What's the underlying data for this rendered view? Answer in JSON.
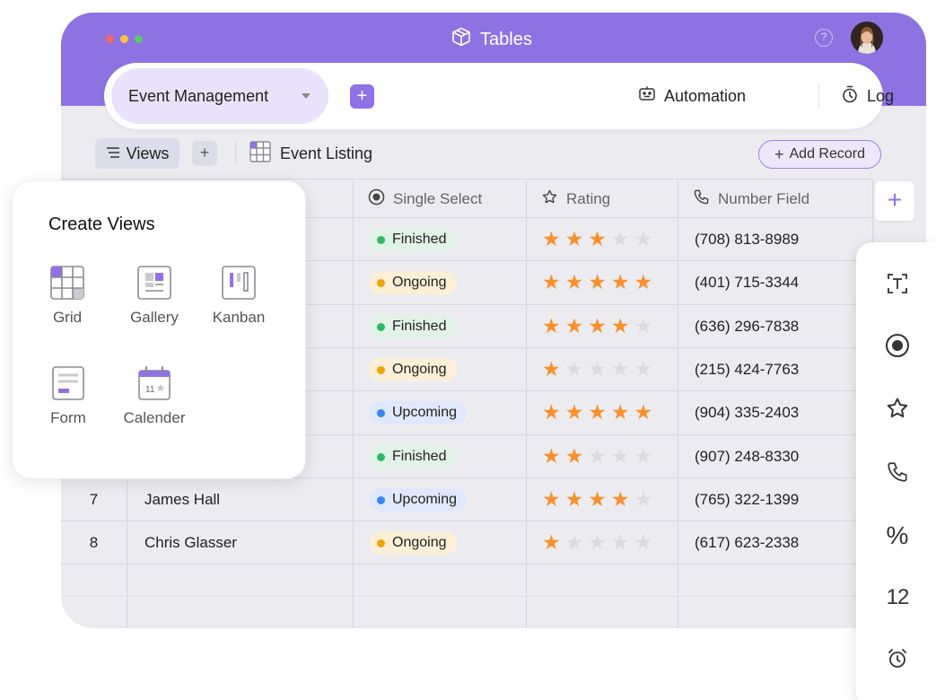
{
  "app": {
    "title": "Tables",
    "help": "?",
    "window_dots": [
      "#f06a6a",
      "#f5c341",
      "#5cc86e"
    ],
    "accent": "#8e72e2"
  },
  "topbar": {
    "project": "Event Management",
    "automation": "Automation",
    "log": "Log"
  },
  "toolbar": {
    "views": "Views",
    "add": "+",
    "listing": "Event Listing",
    "add_record": "Add Record"
  },
  "columns": {
    "single_select": "Single Select",
    "rating": "Rating",
    "number_field": "Number Field"
  },
  "rows": [
    {
      "num": "",
      "name": "",
      "status": "Finished",
      "rating": 3,
      "phone": "(708) 813-8989"
    },
    {
      "num": "",
      "name": "",
      "status": "Ongoing",
      "rating": 5,
      "phone": "(401) 715-3344"
    },
    {
      "num": "",
      "name": "",
      "status": "Finished",
      "rating": 4,
      "phone": "(636) 296-7838"
    },
    {
      "num": "",
      "name": "",
      "status": "Ongoing",
      "rating": 1,
      "phone": "(215) 424-7763"
    },
    {
      "num": "",
      "name": "",
      "status": "Upcoming",
      "rating": 5,
      "phone": "(904) 335-2403"
    },
    {
      "num": "",
      "name": "",
      "status": "Finished",
      "rating": 2,
      "phone": "(907) 248-8330"
    },
    {
      "num": "7",
      "name": "James Hall",
      "status": "Upcoming",
      "rating": 4,
      "phone": "(765) 322-1399"
    },
    {
      "num": "8",
      "name": "Chris Glasser",
      "status": "Ongoing",
      "rating": 1,
      "phone": "(617) 623-2338"
    }
  ],
  "status_colors": {
    "Finished": {
      "dot": "#2fb865",
      "bg": "#e1f2e6"
    },
    "Ongoing": {
      "dot": "#f0a30a",
      "bg": "#fbefd8"
    },
    "Upcoming": {
      "dot": "#3a86f0",
      "bg": "#dfe9fb"
    }
  },
  "star_colors": {
    "on": "#f7902f",
    "off": "#dcdce0"
  },
  "create_views": {
    "title": "Create Views",
    "items": [
      {
        "label": "Grid",
        "icon": "grid-icon"
      },
      {
        "label": "Gallery",
        "icon": "gallery-icon"
      },
      {
        "label": "Kanban",
        "icon": "kanban-icon"
      },
      {
        "label": "Form",
        "icon": "form-icon"
      },
      {
        "label": "Calender",
        "icon": "calendar-icon"
      }
    ]
  },
  "field_types": {
    "add": "+",
    "icons": [
      "text-field-icon",
      "single-select-icon",
      "rating-icon",
      "phone-icon",
      "percent-icon",
      "number-icon",
      "alarm-icon"
    ],
    "percent": "%",
    "number": "12"
  }
}
